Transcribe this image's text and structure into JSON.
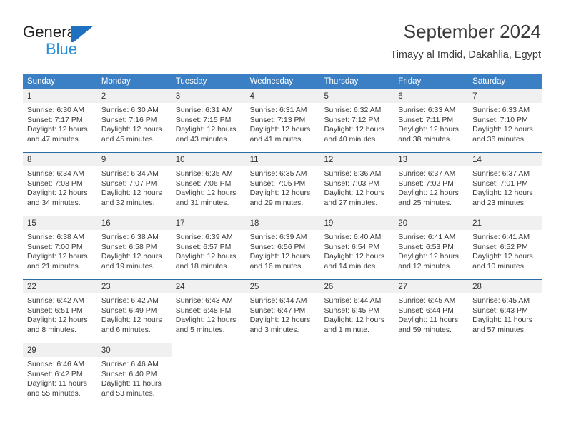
{
  "brand": {
    "name_part1": "General",
    "name_part2": "Blue",
    "flag_icon": "flag-icon",
    "accent_dark": "#231f20",
    "accent_blue": "#2a8fd4",
    "flag_blue": "#1f70c1"
  },
  "header": {
    "title": "September 2024",
    "subtitle": "Timayy al Imdid, Dakahlia, Egypt"
  },
  "theme": {
    "header_bg": "#3b7fc4",
    "week_rule": "#2d6aa8",
    "daynum_band": "#f0f0f0",
    "text": "#3b3b3b"
  },
  "calendar": {
    "day_headers": [
      "Sunday",
      "Monday",
      "Tuesday",
      "Wednesday",
      "Thursday",
      "Friday",
      "Saturday"
    ],
    "weeks": [
      [
        {
          "day": "1",
          "lines": [
            "Sunrise: 6:30 AM",
            "Sunset: 7:17 PM",
            "Daylight: 12 hours",
            "and 47 minutes."
          ]
        },
        {
          "day": "2",
          "lines": [
            "Sunrise: 6:30 AM",
            "Sunset: 7:16 PM",
            "Daylight: 12 hours",
            "and 45 minutes."
          ]
        },
        {
          "day": "3",
          "lines": [
            "Sunrise: 6:31 AM",
            "Sunset: 7:15 PM",
            "Daylight: 12 hours",
            "and 43 minutes."
          ]
        },
        {
          "day": "4",
          "lines": [
            "Sunrise: 6:31 AM",
            "Sunset: 7:13 PM",
            "Daylight: 12 hours",
            "and 41 minutes."
          ]
        },
        {
          "day": "5",
          "lines": [
            "Sunrise: 6:32 AM",
            "Sunset: 7:12 PM",
            "Daylight: 12 hours",
            "and 40 minutes."
          ]
        },
        {
          "day": "6",
          "lines": [
            "Sunrise: 6:33 AM",
            "Sunset: 7:11 PM",
            "Daylight: 12 hours",
            "and 38 minutes."
          ]
        },
        {
          "day": "7",
          "lines": [
            "Sunrise: 6:33 AM",
            "Sunset: 7:10 PM",
            "Daylight: 12 hours",
            "and 36 minutes."
          ]
        }
      ],
      [
        {
          "day": "8",
          "lines": [
            "Sunrise: 6:34 AM",
            "Sunset: 7:08 PM",
            "Daylight: 12 hours",
            "and 34 minutes."
          ]
        },
        {
          "day": "9",
          "lines": [
            "Sunrise: 6:34 AM",
            "Sunset: 7:07 PM",
            "Daylight: 12 hours",
            "and 32 minutes."
          ]
        },
        {
          "day": "10",
          "lines": [
            "Sunrise: 6:35 AM",
            "Sunset: 7:06 PM",
            "Daylight: 12 hours",
            "and 31 minutes."
          ]
        },
        {
          "day": "11",
          "lines": [
            "Sunrise: 6:35 AM",
            "Sunset: 7:05 PM",
            "Daylight: 12 hours",
            "and 29 minutes."
          ]
        },
        {
          "day": "12",
          "lines": [
            "Sunrise: 6:36 AM",
            "Sunset: 7:03 PM",
            "Daylight: 12 hours",
            "and 27 minutes."
          ]
        },
        {
          "day": "13",
          "lines": [
            "Sunrise: 6:37 AM",
            "Sunset: 7:02 PM",
            "Daylight: 12 hours",
            "and 25 minutes."
          ]
        },
        {
          "day": "14",
          "lines": [
            "Sunrise: 6:37 AM",
            "Sunset: 7:01 PM",
            "Daylight: 12 hours",
            "and 23 minutes."
          ]
        }
      ],
      [
        {
          "day": "15",
          "lines": [
            "Sunrise: 6:38 AM",
            "Sunset: 7:00 PM",
            "Daylight: 12 hours",
            "and 21 minutes."
          ]
        },
        {
          "day": "16",
          "lines": [
            "Sunrise: 6:38 AM",
            "Sunset: 6:58 PM",
            "Daylight: 12 hours",
            "and 19 minutes."
          ]
        },
        {
          "day": "17",
          "lines": [
            "Sunrise: 6:39 AM",
            "Sunset: 6:57 PM",
            "Daylight: 12 hours",
            "and 18 minutes."
          ]
        },
        {
          "day": "18",
          "lines": [
            "Sunrise: 6:39 AM",
            "Sunset: 6:56 PM",
            "Daylight: 12 hours",
            "and 16 minutes."
          ]
        },
        {
          "day": "19",
          "lines": [
            "Sunrise: 6:40 AM",
            "Sunset: 6:54 PM",
            "Daylight: 12 hours",
            "and 14 minutes."
          ]
        },
        {
          "day": "20",
          "lines": [
            "Sunrise: 6:41 AM",
            "Sunset: 6:53 PM",
            "Daylight: 12 hours",
            "and 12 minutes."
          ]
        },
        {
          "day": "21",
          "lines": [
            "Sunrise: 6:41 AM",
            "Sunset: 6:52 PM",
            "Daylight: 12 hours",
            "and 10 minutes."
          ]
        }
      ],
      [
        {
          "day": "22",
          "lines": [
            "Sunrise: 6:42 AM",
            "Sunset: 6:51 PM",
            "Daylight: 12 hours",
            "and 8 minutes."
          ]
        },
        {
          "day": "23",
          "lines": [
            "Sunrise: 6:42 AM",
            "Sunset: 6:49 PM",
            "Daylight: 12 hours",
            "and 6 minutes."
          ]
        },
        {
          "day": "24",
          "lines": [
            "Sunrise: 6:43 AM",
            "Sunset: 6:48 PM",
            "Daylight: 12 hours",
            "and 5 minutes."
          ]
        },
        {
          "day": "25",
          "lines": [
            "Sunrise: 6:44 AM",
            "Sunset: 6:47 PM",
            "Daylight: 12 hours",
            "and 3 minutes."
          ]
        },
        {
          "day": "26",
          "lines": [
            "Sunrise: 6:44 AM",
            "Sunset: 6:45 PM",
            "Daylight: 12 hours",
            "and 1 minute."
          ]
        },
        {
          "day": "27",
          "lines": [
            "Sunrise: 6:45 AM",
            "Sunset: 6:44 PM",
            "Daylight: 11 hours",
            "and 59 minutes."
          ]
        },
        {
          "day": "28",
          "lines": [
            "Sunrise: 6:45 AM",
            "Sunset: 6:43 PM",
            "Daylight: 11 hours",
            "and 57 minutes."
          ]
        }
      ],
      [
        {
          "day": "29",
          "lines": [
            "Sunrise: 6:46 AM",
            "Sunset: 6:42 PM",
            "Daylight: 11 hours",
            "and 55 minutes."
          ]
        },
        {
          "day": "30",
          "lines": [
            "Sunrise: 6:46 AM",
            "Sunset: 6:40 PM",
            "Daylight: 11 hours",
            "and 53 minutes."
          ]
        },
        {
          "day": "",
          "lines": []
        },
        {
          "day": "",
          "lines": []
        },
        {
          "day": "",
          "lines": []
        },
        {
          "day": "",
          "lines": []
        },
        {
          "day": "",
          "lines": []
        }
      ]
    ]
  }
}
